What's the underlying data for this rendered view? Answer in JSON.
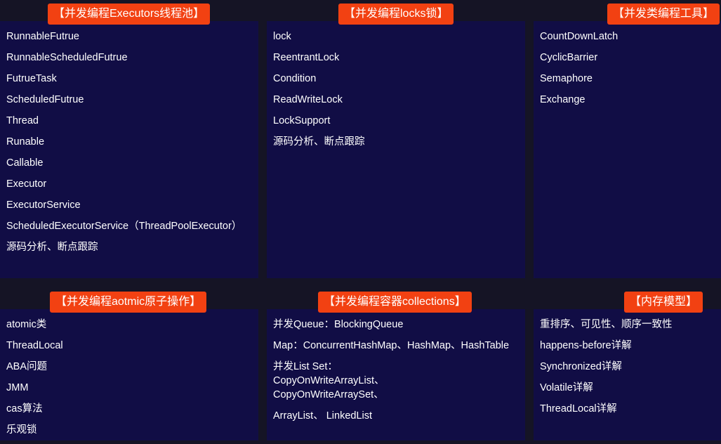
{
  "panels": {
    "executors": {
      "title": "【并发编程Executors线程池】",
      "items": [
        "RunnableFutrue",
        "RunnableScheduledFutrue",
        "FutrueTask",
        "ScheduledFutrue",
        "Thread",
        "Runable",
        "Callable",
        "Executor",
        "ExecutorService",
        "ScheduledExecutorService（ThreadPoolExecutor）",
        "源码分析、断点跟踪"
      ]
    },
    "locks": {
      "title": "【并发编程locks锁】",
      "items": [
        "lock",
        "ReentrantLock",
        "Condition",
        "ReadWriteLock",
        "LockSupport",
        "源码分析、断点跟踪"
      ]
    },
    "tools": {
      "title": "【并发类编程工具】",
      "items": [
        "CountDownLatch",
        "CyclicBarrier",
        "Semaphore",
        "Exchange"
      ]
    },
    "atomic": {
      "title": "【并发编程aotmic原子操作】",
      "items": [
        "atomic类",
        "ThreadLocal",
        "ABA问题",
        "JMM",
        "cas算法",
        "乐观锁"
      ]
    },
    "collections": {
      "title": "【并发编程容器collections】",
      "items": [
        "并发Queue：BlockingQueue",
        "Map：ConcurrentHashMap、HashMap、HashTable",
        "并发List Set：CopyOnWriteArrayList、CopyOnWriteArraySet、",
        "ArrayList、 LinkedList"
      ]
    },
    "memory": {
      "title": "【内存模型】",
      "items": [
        "重排序、可见性、顺序一致性",
        "happens-before详解",
        "Synchronized详解",
        "Volatile详解",
        "ThreadLocal详解"
      ]
    }
  }
}
